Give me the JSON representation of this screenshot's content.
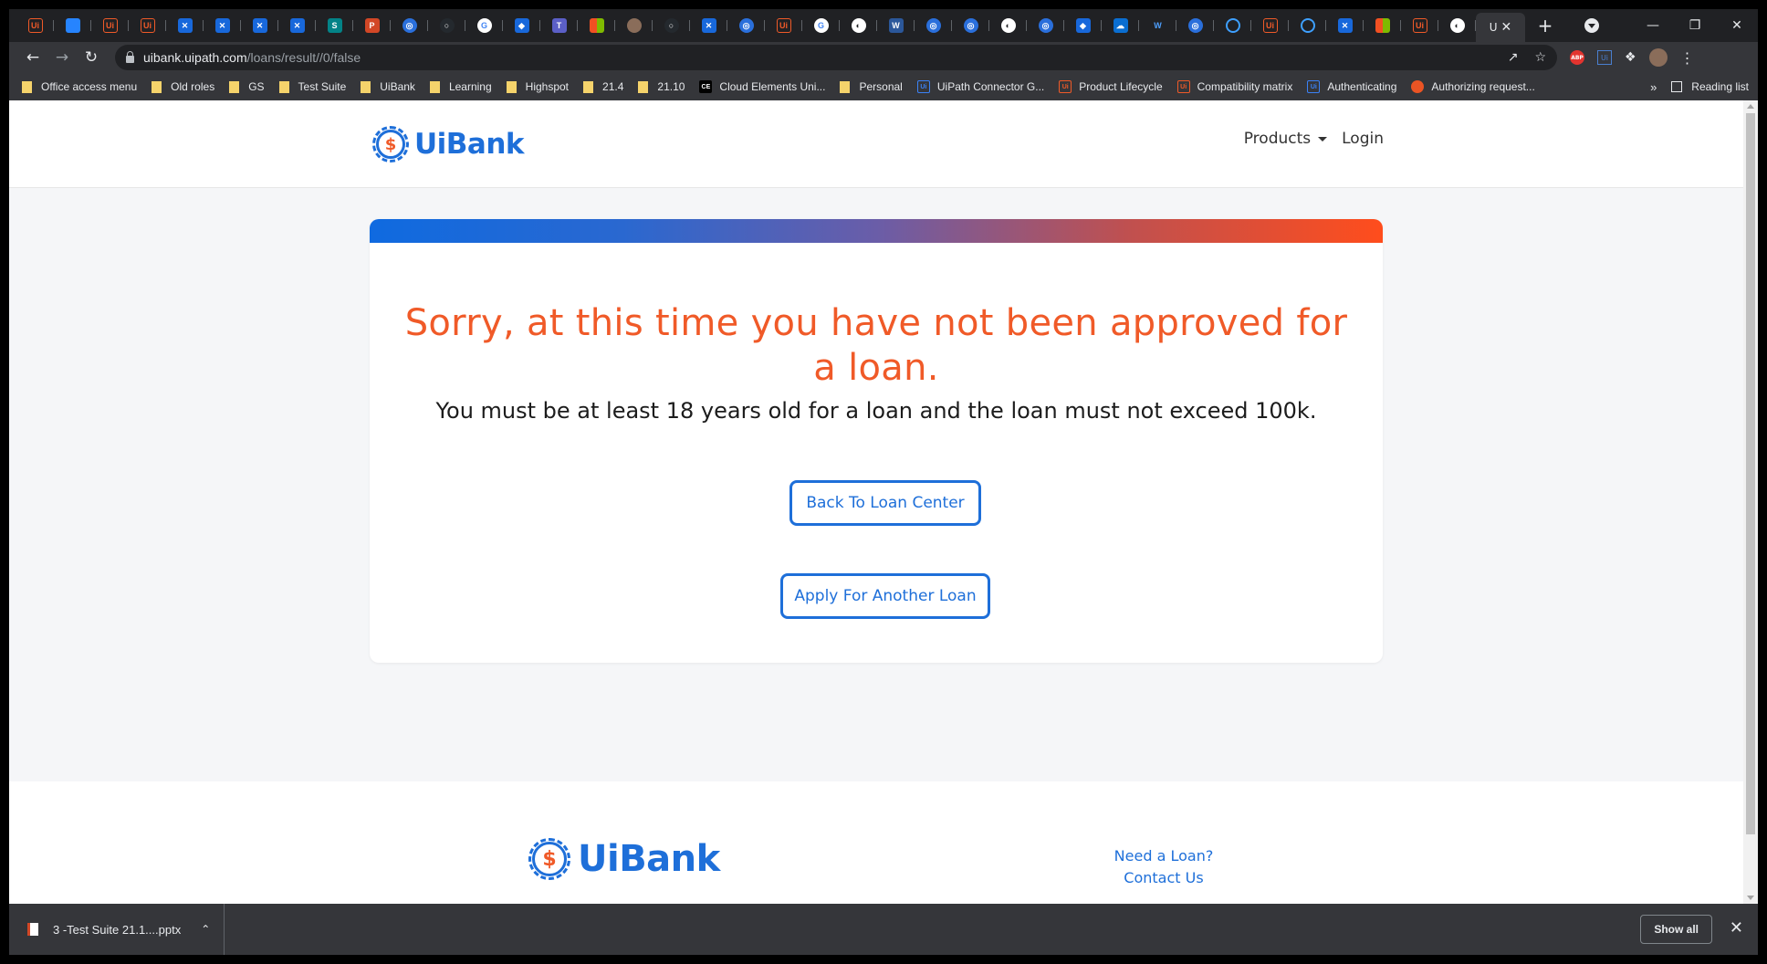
{
  "browser": {
    "tab_favicons": [
      "uipath",
      "jira",
      "uipath",
      "uipath",
      "confluence",
      "confluence",
      "confluence",
      "confluence",
      "sharepoint",
      "powerpoint",
      "globe-blue",
      "github",
      "google",
      "diamond",
      "teams",
      "microsoft",
      "avatar",
      "github",
      "confluence",
      "globe-blue",
      "uipath",
      "google",
      "globe-white",
      "word",
      "globe-blue",
      "globe-blue",
      "globe-white",
      "globe-blue",
      "diamond",
      "onedrive",
      "w",
      "globe-blue",
      "circle",
      "uipath",
      "circle",
      "confluence",
      "microsoft",
      "uipath",
      "globe-white"
    ],
    "active_tab_letter": "U",
    "url_host": "uibank.uipath.com",
    "url_path": "/loans/result//0/false",
    "bookmarks": [
      {
        "label": "Office access menu",
        "type": "folder"
      },
      {
        "label": "Old roles",
        "type": "folder"
      },
      {
        "label": "GS",
        "type": "folder"
      },
      {
        "label": "Test Suite",
        "type": "folder"
      },
      {
        "label": "UiBank",
        "type": "folder"
      },
      {
        "label": "Learning",
        "type": "folder"
      },
      {
        "label": "Highspot",
        "type": "folder"
      },
      {
        "label": "21.4",
        "type": "folder"
      },
      {
        "label": "21.10",
        "type": "folder"
      },
      {
        "label": "Cloud Elements Uni...",
        "type": "ce"
      },
      {
        "label": "Personal",
        "type": "folder"
      },
      {
        "label": "UiPath Connector G...",
        "type": "ui-blue"
      },
      {
        "label": "Product Lifecycle",
        "type": "ui-orange"
      },
      {
        "label": "Compatibility matrix",
        "type": "ui-orange"
      },
      {
        "label": "Authenticating",
        "type": "ui-blue"
      },
      {
        "label": "Authorizing request...",
        "type": "auth0"
      }
    ],
    "reading_list": "Reading list"
  },
  "site": {
    "brand": "UiBank",
    "coin_symbol": "$",
    "nav_products": "Products",
    "nav_login": "Login",
    "title": "Sorry, at this time you have not been approved for a loan.",
    "message": "You must be at least 18 years old for a loan and the loan must not exceed 100k.",
    "btn_back": "Back To Loan Center",
    "btn_apply": "Apply For Another Loan",
    "footer_link1": "Need a Loan?",
    "footer_link2": "Contact Us"
  },
  "downloads": {
    "file": "3 -Test Suite 21.1....pptx",
    "show_all": "Show all"
  },
  "colors": {
    "brand_blue": "#1e6fd9",
    "accent_orange": "#f05a28"
  }
}
